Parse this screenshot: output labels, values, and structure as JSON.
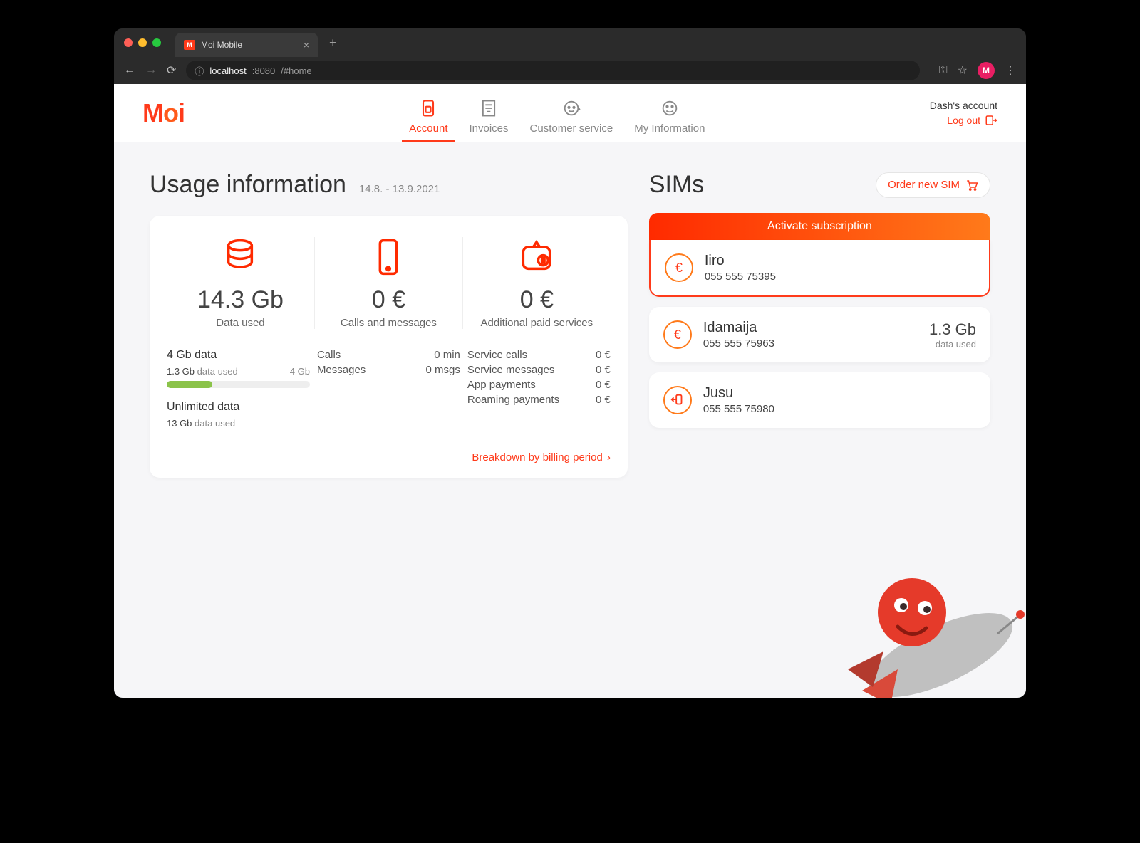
{
  "browser": {
    "tab_title": "Moi Mobile",
    "url_host": "localhost",
    "url_port": ":8080",
    "url_path": "/#home",
    "avatar_letter": "M"
  },
  "header": {
    "logo_text": "Moi",
    "tabs": [
      "Account",
      "Invoices",
      "Customer service",
      "My Information"
    ],
    "account_label": "Dash's account",
    "logout": "Log out"
  },
  "usage": {
    "title": "Usage information",
    "period": "14.8. - 13.9.2021",
    "metrics": {
      "data": {
        "value": "14.3 Gb",
        "label": "Data used"
      },
      "calls": {
        "value": "0 €",
        "label": "Calls and messages"
      },
      "services": {
        "value": "0 €",
        "label": "Additional paid services"
      }
    },
    "plan1": {
      "title": "4 Gb data",
      "used": "1.3 Gb",
      "used_lbl": "data used",
      "cap": "4 Gb"
    },
    "plan2": {
      "title": "Unlimited data",
      "used": "13 Gb",
      "used_lbl": "data used"
    },
    "calls_rows": {
      "calls_lbl": "Calls",
      "calls_val": "0 min",
      "msgs_lbl": "Messages",
      "msgs_val": "0 msgs"
    },
    "services_rows": {
      "r1l": "Service calls",
      "r1v": "0 €",
      "r2l": "Service messages",
      "r2v": "0 €",
      "r3l": "App payments",
      "r3v": "0 €",
      "r4l": "Roaming payments",
      "r4v": "0 €"
    },
    "breakdown_link": "Breakdown by billing period"
  },
  "sims": {
    "title": "SIMs",
    "order_btn": "Order new SIM",
    "activate": "Activate subscription",
    "items": [
      {
        "name": "Iiro",
        "number": "055 555 75395"
      },
      {
        "name": "Idamaija",
        "number": "055 555 75963",
        "usage_val": "1.3 Gb",
        "usage_lbl": "data used"
      },
      {
        "name": "Jusu",
        "number": "055 555 75980"
      }
    ]
  }
}
